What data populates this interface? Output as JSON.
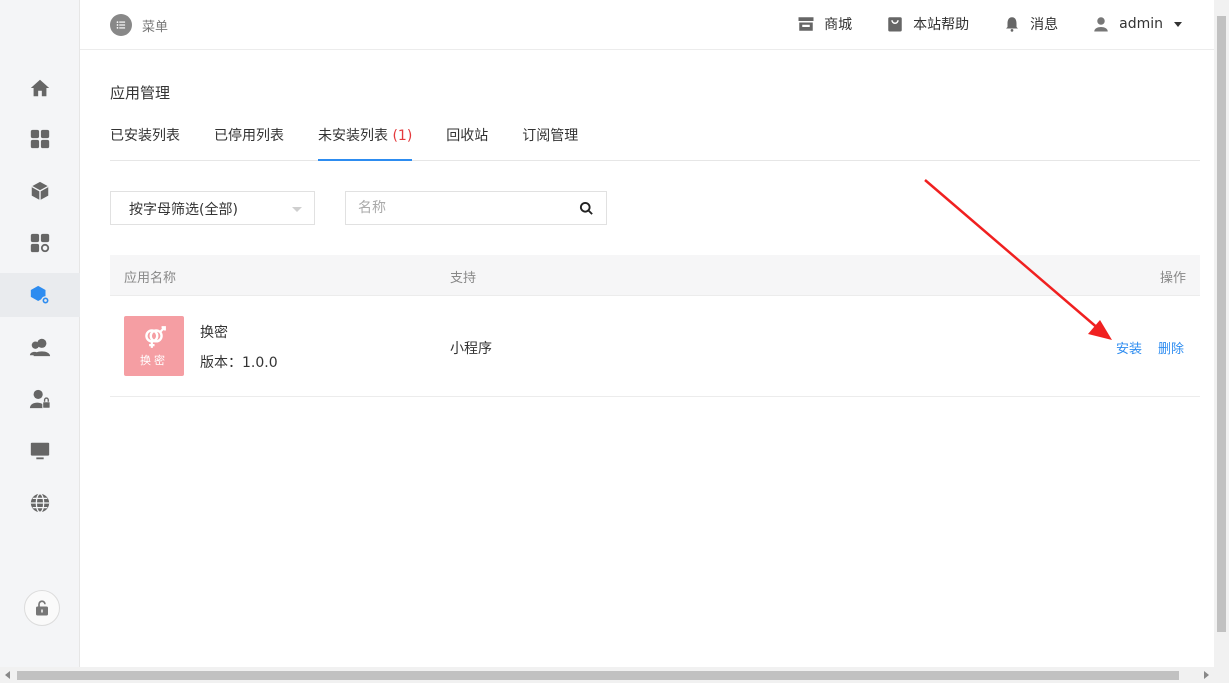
{
  "topbar": {
    "menu_label": "菜单",
    "shop_label": "商城",
    "help_label": "本站帮助",
    "messages_label": "消息",
    "user_label": "admin"
  },
  "page": {
    "title": "应用管理",
    "tabs": [
      {
        "label": "已安装列表"
      },
      {
        "label": "已停用列表"
      },
      {
        "label": "未安装列表",
        "count": "(1)",
        "active": true
      },
      {
        "label": "回收站"
      },
      {
        "label": "订阅管理"
      }
    ]
  },
  "filters": {
    "letter_filter_value": "按字母筛选(全部)",
    "search_placeholder": "名称"
  },
  "table": {
    "headers": [
      "应用名称",
      "支持",
      "操作"
    ],
    "rows": [
      {
        "logo_text": "换密",
        "name": "换密",
        "version": "版本：1.0.0",
        "support": "小程序",
        "install_label": "安装",
        "delete_label": "删除"
      }
    ]
  },
  "colors": {
    "accent": "#2d8cf0",
    "count": "#e4393c",
    "logo_bg": "#f59ea3",
    "annotation_arrow": "#f02020"
  }
}
